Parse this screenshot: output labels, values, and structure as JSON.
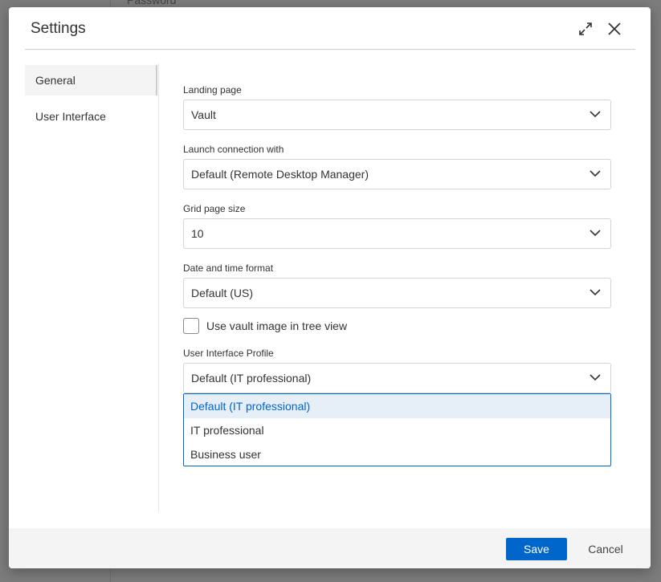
{
  "background": {
    "text": "Password"
  },
  "dialog": {
    "title": "Settings"
  },
  "sidebar": {
    "items": [
      {
        "label": "General",
        "active": true
      },
      {
        "label": "User Interface"
      }
    ]
  },
  "fields": [
    {
      "label": "Landing page",
      "value": "Vault"
    },
    {
      "label": "Launch connection with",
      "value": "Default (Remote Desktop Manager)"
    },
    {
      "label": "Grid page size",
      "value": "10"
    },
    {
      "label": "Date and time format",
      "value": "Default (US)"
    }
  ],
  "checkbox": {
    "label": "Use vault image in tree view",
    "checked": false
  },
  "profile": {
    "label": "User Interface Profile",
    "value": "Default (IT professional)",
    "options": [
      "Default (IT professional)",
      "IT professional",
      "Business user"
    ]
  },
  "footer": {
    "save": "Save",
    "cancel": "Cancel"
  },
  "colors": {
    "accent": "#0066cc"
  }
}
